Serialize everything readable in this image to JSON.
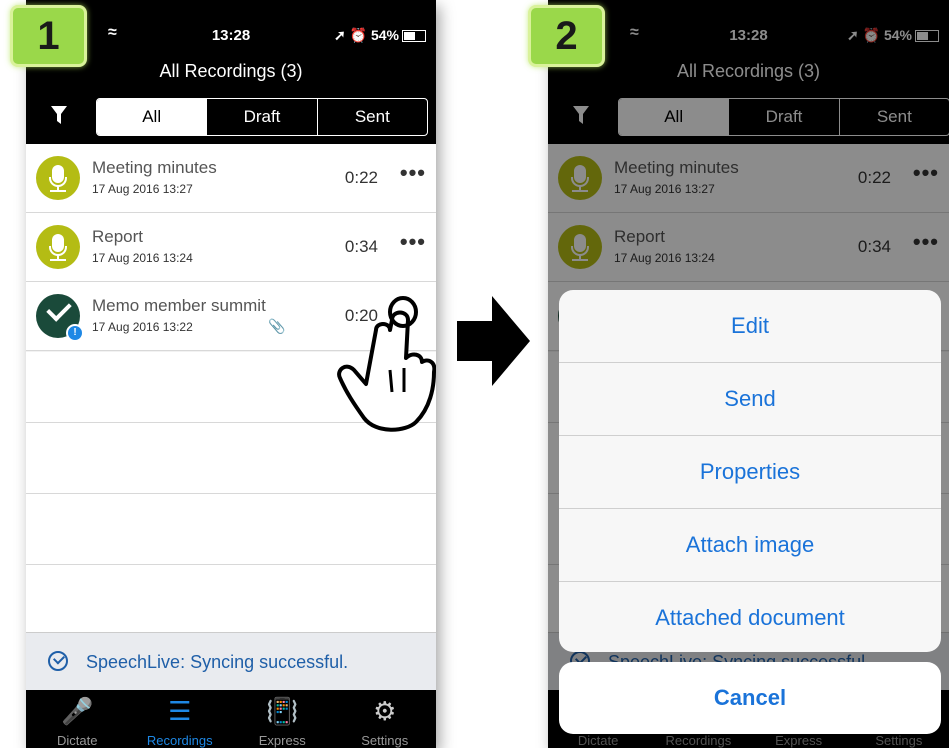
{
  "steps": {
    "first": "1",
    "second": "2"
  },
  "status": {
    "time": "13:28",
    "battery": "54%",
    "icons": "wifi-icon, location-icon, alarm-icon, battery-icon"
  },
  "screen": {
    "title": "All Recordings (3)",
    "filter_icon": "filter-icon",
    "tabs": [
      "All",
      "Draft",
      "Sent"
    ],
    "recordings": [
      {
        "title": "Meeting minutes",
        "date": "17 Aug 2016 13:27",
        "duration": "0:22",
        "more": "•••",
        "icon": "microphone-icon"
      },
      {
        "title": "Report",
        "date": "17 Aug 2016 13:24",
        "duration": "0:34",
        "more": "•••",
        "icon": "microphone-icon"
      },
      {
        "title": "Memo member summit",
        "date": "17 Aug 2016 13:22",
        "duration": "0:20",
        "icon": "check-icon",
        "attachment_icon": "paperclip-icon",
        "info_icon": "info-icon"
      }
    ],
    "sync_status": "SpeechLive: Syncing successful.",
    "sync_status_dimmed": "SpeechLive: Syncing successful",
    "tabbar": [
      {
        "label": "Dictate",
        "icon": "microphone-icon"
      },
      {
        "label": "Recordings",
        "icon": "list-icon"
      },
      {
        "label": "Express",
        "icon": "phone-vibrate-icon"
      },
      {
        "label": "Settings",
        "icon": "gear-icon"
      }
    ]
  },
  "action_sheet": {
    "options": [
      "Edit",
      "Send",
      "Properties",
      "Attach image",
      "Attached document"
    ],
    "cancel": "Cancel"
  },
  "colors": {
    "accent": "#1a73d9",
    "record_icon": "#b4bc14",
    "done_icon": "#1a4a3a",
    "badge": "#9ad84a"
  }
}
